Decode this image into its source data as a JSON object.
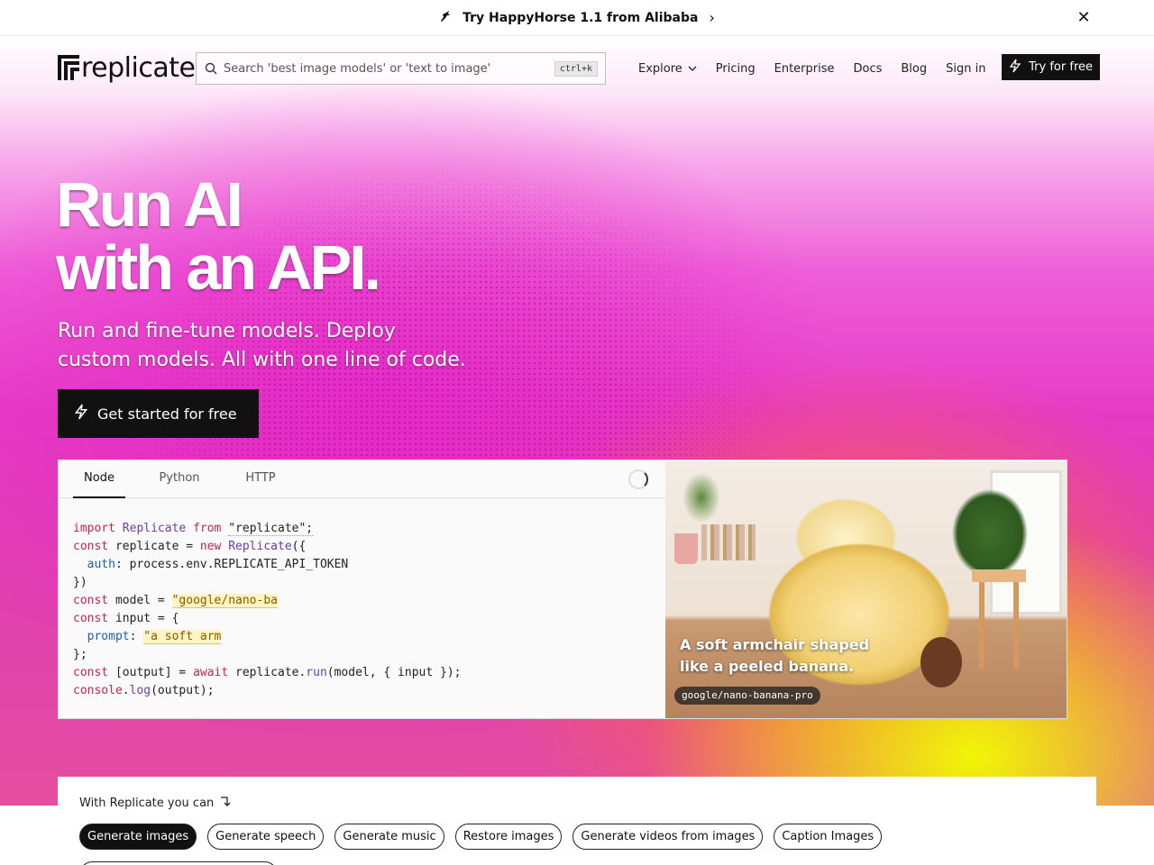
{
  "announcement": {
    "text": "Try HappyHorse 1.1 from Alibaba",
    "horse_icon": "horse-icon",
    "chevron": "›",
    "close": "✕"
  },
  "nav": {
    "logo_text": "replicate",
    "search_placeholder": "Search 'best image models' or 'text to image'",
    "search_shortcut": "ctrl+k",
    "links": [
      "Explore",
      "Pricing",
      "Enterprise",
      "Docs",
      "Blog",
      "Sign in"
    ],
    "cta_label": "Try for free"
  },
  "hero": {
    "title_line1": "Run AI",
    "title_line2": "with an API.",
    "subtitle_line1": "Run and fine-tune models. Deploy",
    "subtitle_line2": "custom models. All with one line of code.",
    "cta_label": "Get started for free"
  },
  "code_panel": {
    "tabs": [
      "Node",
      "Python",
      "HTTP"
    ],
    "active_tab": "Node",
    "lines": {
      "l1_import": "import",
      "l1_class": "Replicate",
      "l1_from": "from",
      "l1_module": "\"replicate\";",
      "l2_const": "const",
      "l2_rest1": " replicate = ",
      "l2_new": "new",
      "l2_class": "Replicate",
      "l2_rest2": "({",
      "l3_prop": "auth",
      "l3_rest": ": process.env.REPLICATE_API_TOKEN",
      "l4": "})",
      "l5_const": "const",
      "l5_rest": " model = ",
      "l5_value": "\"google/nano-ba",
      "l6_const": "const",
      "l6_rest": " input = {",
      "l7_prop": "prompt",
      "l7_value": "\"a soft arm",
      "l8": "};",
      "l9_const": "const",
      "l9_rest1": " [output] = ",
      "l9_await": "await",
      "l9_rest2": " replicate.",
      "l9_fn": "run",
      "l9_rest3": "(model, { input });",
      "l10_obj": "console",
      "l10_dot": ".",
      "l10_fn": "log",
      "l10_rest": "(output);"
    },
    "image_caption_line1": "A soft armchair shaped",
    "image_caption_line2": "like a peeled banana.",
    "image_model": "google/nano-banana-pro"
  },
  "capabilities": {
    "heading": "With Replicate you can",
    "chips": [
      "Generate images",
      "Generate speech",
      "Generate music",
      "Restore images",
      "Generate videos from images",
      "Caption Images"
    ],
    "active_chip": "Generate images"
  },
  "colors": {
    "dark": "#111111",
    "magenta": "#e53bc4",
    "yellow": "#f0ff00"
  }
}
